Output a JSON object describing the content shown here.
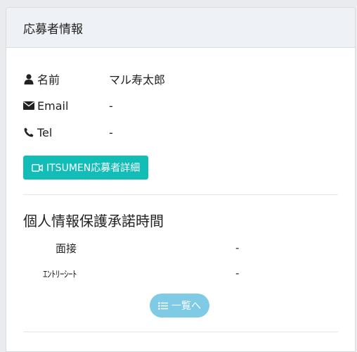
{
  "header": {
    "title": "応募者情報"
  },
  "applicant": {
    "rows": [
      {
        "icon": "user-icon",
        "label": "名前",
        "value": "マル寿太郎"
      },
      {
        "icon": "envelope-icon",
        "label": "Email",
        "value": "-"
      },
      {
        "icon": "phone-icon",
        "label": "Tel",
        "value": "-"
      }
    ]
  },
  "buttons": {
    "itsumen_label": "ITSUMEN応募者詳細",
    "list_label": "一覧へ"
  },
  "consent": {
    "title": "個人情報保護承諾時間",
    "rows": [
      {
        "label": "面接",
        "value": "-"
      },
      {
        "label": "ｴﾝﾄﾘｰｼｰﾄ",
        "value": "-"
      }
    ]
  },
  "colors": {
    "itsumen_button": "#12bdb8",
    "list_button": "#7fcbe6",
    "header_bg": "#eef2f6"
  }
}
